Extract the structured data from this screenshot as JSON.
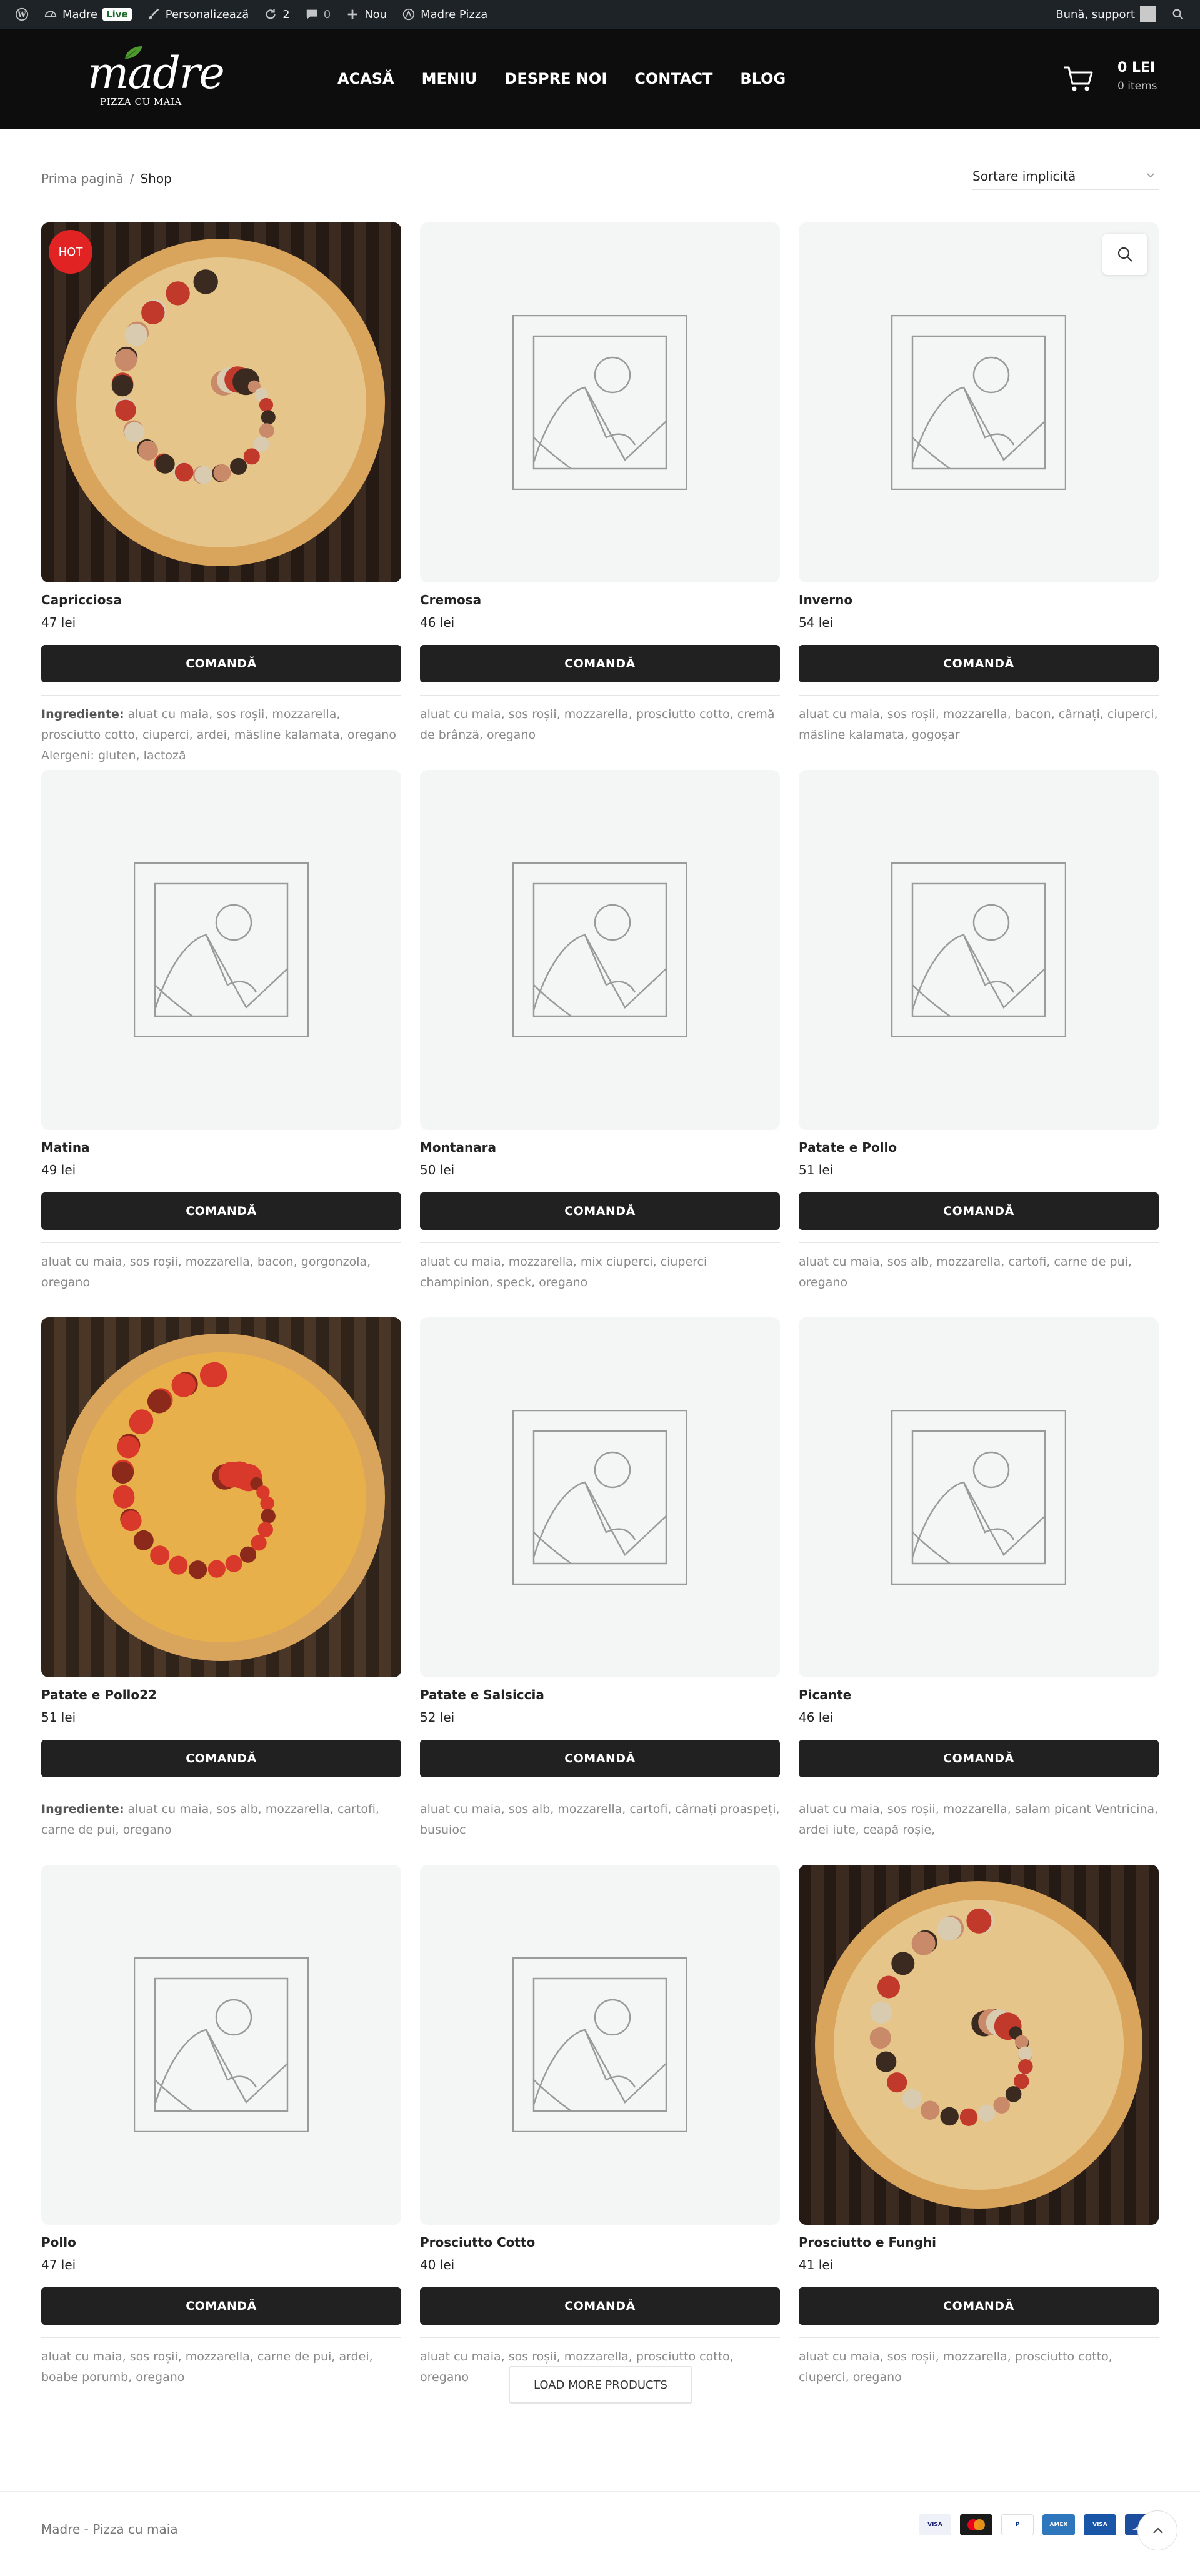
{
  "admin_bar": {
    "site_name": "Madre",
    "live_badge": "Live",
    "customize": "Personalizează",
    "updates_count": "2",
    "comments_count": "0",
    "new_label": "Nou",
    "plugin_label": "Madre Pizza",
    "greeting": "Bună, support"
  },
  "header": {
    "logo_text": "madre",
    "logo_tagline": "PIZZA CU MAIA",
    "nav": [
      "ACASĂ",
      "MENIU",
      "DESPRE NOI",
      "CONTACT",
      "BLOG"
    ],
    "cart_total": "0 LEI",
    "cart_items": "0 items"
  },
  "toolbar": {
    "breadcrumb_home": "Prima pagină",
    "breadcrumb_sep": "/",
    "breadcrumb_current": "Shop",
    "sort_selected": "Sortare implicită"
  },
  "products": [
    {
      "name": "Capricciosa",
      "price": "47 lei",
      "image": "pizza-photo",
      "badge": "HOT",
      "desc_label": "Ingrediente:",
      "desc": " aluat cu maia, sos roșii, mozzarella, prosciutto cotto, ciuperci, ardei, măsline kalamata, oregano Alergeni: gluten, lactoză"
    },
    {
      "name": "Cremosa",
      "price": "46 lei",
      "image": "placeholder",
      "desc_label": "",
      "desc": "aluat cu maia, sos roșii, mozzarella, prosciutto cotto, cremă de brânză, oregano"
    },
    {
      "name": "Inverno",
      "price": "54 lei",
      "image": "placeholder",
      "quickview": true,
      "desc_label": "",
      "desc": "aluat cu maia, sos roșii, mozzarella, bacon, cârnați, ciuperci, măsline kalamata, gogoșar"
    },
    {
      "name": "Matina",
      "price": "49 lei",
      "image": "placeholder",
      "desc_label": "",
      "desc": "aluat cu maia, sos roșii, mozzarella, bacon, gorgonzola, oregano"
    },
    {
      "name": "Montanara",
      "price": "50 lei",
      "image": "placeholder",
      "desc_label": "",
      "desc": "aluat cu maia, mozzarella, mix ciuperci, ciuperci champinion, speck, oregano"
    },
    {
      "name": "Patate e Pollo",
      "price": "51 lei",
      "image": "placeholder",
      "desc_label": "",
      "desc": "aluat cu maia, sos alb, mozzarella, cartofi, carne de pui, oregano"
    },
    {
      "name": "Patate e Pollo22",
      "price": "51 lei",
      "image": "pizza-photo",
      "desc_label": "Ingrediente:",
      "desc": " aluat cu maia, sos alb, mozzarella, cartofi, carne de pui, oregano"
    },
    {
      "name": "Patate e Salsiccia",
      "price": "52 lei",
      "image": "placeholder",
      "desc_label": "",
      "desc": "aluat cu maia, sos alb, mozzarella, cartofi, cârnați proaspeți, busuioc"
    },
    {
      "name": "Picante",
      "price": "46 lei",
      "image": "placeholder",
      "desc_label": "",
      "desc": "aluat cu maia, sos roșii, mozzarella, salam picant Ventricina, ardei iute, ceapă roșie,"
    },
    {
      "name": "Pollo",
      "price": "47 lei",
      "image": "placeholder",
      "desc_label": "",
      "desc": "aluat cu maia, sos roșii, mozzarella, carne de pui, ardei, boabe porumb, oregano"
    },
    {
      "name": "Prosciutto Cotto",
      "price": "40 lei",
      "image": "placeholder",
      "desc_label": "",
      "desc": "aluat cu maia, sos roșii, mozzarella, prosciutto cotto, oregano"
    },
    {
      "name": "Prosciutto e Funghi",
      "price": "41 lei",
      "image": "pizza-photo",
      "desc_label": "",
      "desc": "aluat cu maia, sos roșii, mozzarella, prosciutto cotto, ciuperci, oregano"
    }
  ],
  "order_button_label": "COMANDĂ",
  "load_more_label": "LOAD MORE PRODUCTS",
  "footer": {
    "copyright": "Madre - Pizza cu maia",
    "payment_icons": [
      "visa-icon",
      "mastercard-icon",
      "paypal-icon",
      "amex-icon",
      "visa-electron-icon",
      "maestro-icon"
    ]
  },
  "colors": {
    "admin_bar": "#1d2327",
    "header_bg": "#0d0d0d",
    "button_bg": "#212121",
    "hot_badge": "#e12323",
    "placeholder_bg": "#f4f6f5"
  }
}
